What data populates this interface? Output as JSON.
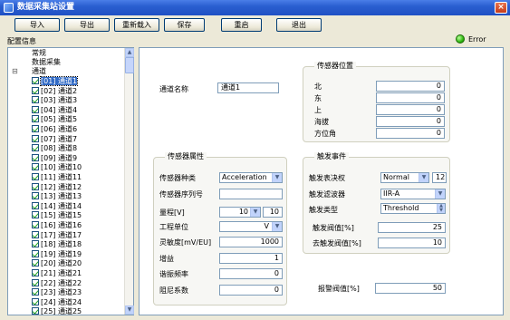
{
  "window": {
    "title": "数据采集站设置",
    "close_glyph": "×"
  },
  "toolbar": {
    "import": "导入",
    "export": "导出",
    "reload": "重新载入",
    "save": "保存",
    "restart": "重启",
    "exit": "退出"
  },
  "config_label": "配置信息",
  "error_label": "Error",
  "tree": {
    "root_items": [
      "常规",
      "数据采集",
      "通道"
    ],
    "expander": "⊟",
    "channels": [
      "[01] 通道1",
      "[02] 通道2",
      "[03] 通道3",
      "[04] 通道4",
      "[05] 通道5",
      "[06] 通道6",
      "[07] 通道7",
      "[08] 通道8",
      "[09] 通道9",
      "[10] 通道10",
      "[11] 通道11",
      "[12] 通道12",
      "[13] 通道13",
      "[14] 通道14",
      "[15] 通道15",
      "[16] 通道16",
      "[17] 通道17",
      "[18] 通道18",
      "[19] 通道19",
      "[20] 通道20",
      "[21] 通道21",
      "[22] 通道22",
      "[23] 通道23",
      "[24] 通道24",
      "[25] 通道25"
    ]
  },
  "channel_name": {
    "label": "通道名称",
    "value": "通道1"
  },
  "sensor_position": {
    "title": "传感器位置",
    "rows": [
      {
        "label": "北",
        "value": "0"
      },
      {
        "label": "东",
        "value": "0"
      },
      {
        "label": "上",
        "value": "0"
      },
      {
        "label": "海拔",
        "value": "0"
      },
      {
        "label": "方位角",
        "value": "0"
      }
    ]
  },
  "sensor_props": {
    "title": "传感器属性",
    "type_label": "传感器种类",
    "type_value": "Acceleration",
    "serial_label": "传感器序列号",
    "serial_value": "",
    "range_label": "量程[V]",
    "range_value": "10",
    "range_value2": "10",
    "unit_label": "工程单位",
    "unit_value": "V",
    "sensitivity_label": "灵敏度[mV/EU]",
    "sensitivity_value": "1000",
    "gain_label": "增益",
    "gain_value": "1",
    "resonance_label": "谐振频率",
    "resonance_value": "0",
    "damping_label": "阻尼系数",
    "damping_value": "0"
  },
  "trigger": {
    "title": "触发事件",
    "vote_label": "触发表决权",
    "vote_mode": "Normal",
    "vote_value": "12",
    "filter_label": "触发滤波器",
    "filter_value": "IIR-A",
    "type_label": "触发类型",
    "type_value": "Threshold",
    "threshold_label": "触发阀值[%]",
    "threshold_value": "25",
    "detrigger_label": "去触发阀值[%]",
    "detrigger_value": "10"
  },
  "alarm": {
    "label": "报警阀值[%]",
    "value": "50"
  }
}
